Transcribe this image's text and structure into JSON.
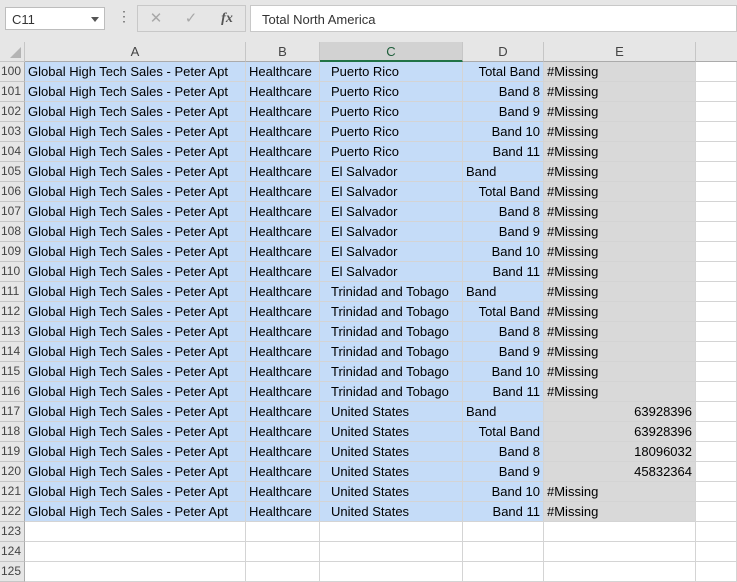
{
  "formula_bar": {
    "name_box": "C11",
    "cancel_icon": "✕",
    "enter_icon": "✓",
    "fx_label": "fx",
    "formula_text": "Total North America"
  },
  "columns": [
    "A",
    "B",
    "C",
    "D",
    "E"
  ],
  "selected_column": "C",
  "rows": [
    {
      "num": "100",
      "a": "Global High Tech Sales - Peter Apt",
      "b": "Healthcare",
      "c": "Puerto Rico",
      "d": "Total Band",
      "e": "#Missing"
    },
    {
      "num": "101",
      "a": "Global High Tech Sales - Peter Apt",
      "b": "Healthcare",
      "c": "Puerto Rico",
      "d": "Band 8",
      "e": "#Missing"
    },
    {
      "num": "102",
      "a": "Global High Tech Sales - Peter Apt",
      "b": "Healthcare",
      "c": "Puerto Rico",
      "d": "Band 9",
      "e": "#Missing"
    },
    {
      "num": "103",
      "a": "Global High Tech Sales - Peter Apt",
      "b": "Healthcare",
      "c": "Puerto Rico",
      "d": "Band 10",
      "e": "#Missing"
    },
    {
      "num": "104",
      "a": "Global High Tech Sales - Peter Apt",
      "b": "Healthcare",
      "c": "Puerto Rico",
      "d": "Band 11",
      "e": "#Missing"
    },
    {
      "num": "105",
      "a": "Global High Tech Sales - Peter Apt",
      "b": "Healthcare",
      "c": "El Salvador",
      "d": "Band",
      "e": "#Missing"
    },
    {
      "num": "106",
      "a": "Global High Tech Sales - Peter Apt",
      "b": "Healthcare",
      "c": "El Salvador",
      "d": "Total Band",
      "e": "#Missing"
    },
    {
      "num": "107",
      "a": "Global High Tech Sales - Peter Apt",
      "b": "Healthcare",
      "c": "El Salvador",
      "d": "Band 8",
      "e": "#Missing"
    },
    {
      "num": "108",
      "a": "Global High Tech Sales - Peter Apt",
      "b": "Healthcare",
      "c": "El Salvador",
      "d": "Band 9",
      "e": "#Missing"
    },
    {
      "num": "109",
      "a": "Global High Tech Sales - Peter Apt",
      "b": "Healthcare",
      "c": "El Salvador",
      "d": "Band 10",
      "e": "#Missing"
    },
    {
      "num": "110",
      "a": "Global High Tech Sales - Peter Apt",
      "b": "Healthcare",
      "c": "El Salvador",
      "d": "Band 11",
      "e": "#Missing"
    },
    {
      "num": "111",
      "a": "Global High Tech Sales - Peter Apt",
      "b": "Healthcare",
      "c": "Trinidad and Tobago",
      "d": "Band",
      "e": "#Missing"
    },
    {
      "num": "112",
      "a": "Global High Tech Sales - Peter Apt",
      "b": "Healthcare",
      "c": "Trinidad and Tobago",
      "d": "Total Band",
      "e": "#Missing"
    },
    {
      "num": "113",
      "a": "Global High Tech Sales - Peter Apt",
      "b": "Healthcare",
      "c": "Trinidad and Tobago",
      "d": "Band 8",
      "e": "#Missing"
    },
    {
      "num": "114",
      "a": "Global High Tech Sales - Peter Apt",
      "b": "Healthcare",
      "c": "Trinidad and Tobago",
      "d": "Band 9",
      "e": "#Missing"
    },
    {
      "num": "115",
      "a": "Global High Tech Sales - Peter Apt",
      "b": "Healthcare",
      "c": "Trinidad and Tobago",
      "d": "Band 10",
      "e": "#Missing"
    },
    {
      "num": "116",
      "a": "Global High Tech Sales - Peter Apt",
      "b": "Healthcare",
      "c": "Trinidad and Tobago",
      "d": "Band 11",
      "e": "#Missing"
    },
    {
      "num": "117",
      "a": "Global High Tech Sales - Peter Apt",
      "b": "Healthcare",
      "c": "United States",
      "d": "Band",
      "e": "63928396"
    },
    {
      "num": "118",
      "a": "Global High Tech Sales - Peter Apt",
      "b": "Healthcare",
      "c": "United States",
      "d": "Total Band",
      "e": "63928396"
    },
    {
      "num": "119",
      "a": "Global High Tech Sales - Peter Apt",
      "b": "Healthcare",
      "c": "United States",
      "d": "Band 8",
      "e": "18096032"
    },
    {
      "num": "120",
      "a": "Global High Tech Sales - Peter Apt",
      "b": "Healthcare",
      "c": "United States",
      "d": "Band 9",
      "e": "45832364"
    },
    {
      "num": "121",
      "a": "Global High Tech Sales - Peter Apt",
      "b": "Healthcare",
      "c": "United States",
      "d": "Band 10",
      "e": "#Missing"
    },
    {
      "num": "122",
      "a": "Global High Tech Sales - Peter Apt",
      "b": "Healthcare",
      "c": "United States",
      "d": "Band 11",
      "e": "#Missing"
    },
    {
      "num": "123",
      "a": "",
      "b": "",
      "c": "",
      "d": "",
      "e": ""
    },
    {
      "num": "124",
      "a": "",
      "b": "",
      "c": "",
      "d": "",
      "e": ""
    },
    {
      "num": "125",
      "a": "",
      "b": "",
      "c": "",
      "d": "",
      "e": ""
    }
  ]
}
